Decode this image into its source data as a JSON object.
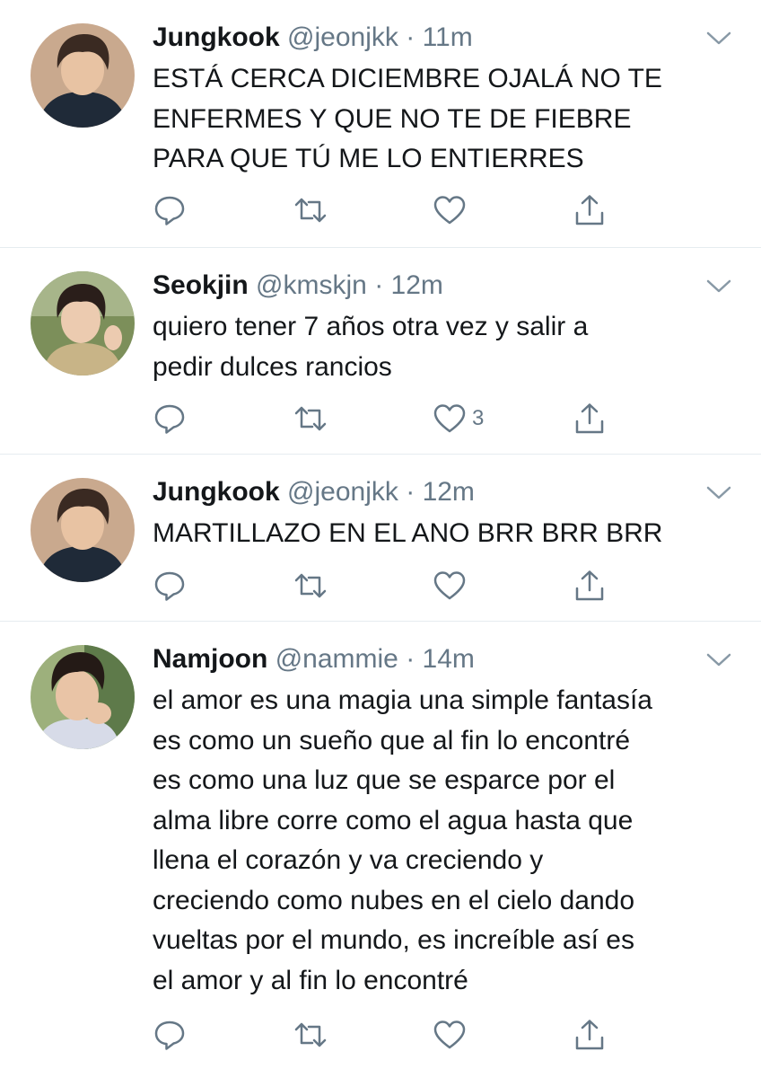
{
  "colors": {
    "name": "#14171a",
    "meta": "#657786",
    "divider": "#e6ecf0",
    "icon": "#657786"
  },
  "tweets": [
    {
      "name": "Jungkook",
      "handle": "@jeonjkk",
      "separator": "·",
      "time": "11m",
      "lines": [
        "ESTÁ CERCA DICIEMBRE OJALÁ NO TE",
        "ENFERMES Y QUE NO TE DE FIEBRE",
        "PARA QUE TÚ ME LO ENTIERRES"
      ],
      "like_count": ""
    },
    {
      "name": "Seokjin",
      "handle": "@kmskjn",
      "separator": "·",
      "time": "12m",
      "lines": [
        "quiero tener 7 años otra vez y salir a",
        "pedir dulces rancios"
      ],
      "like_count": "3"
    },
    {
      "name": "Jungkook",
      "handle": "@jeonjkk",
      "separator": "·",
      "time": "12m",
      "lines": [
        "MARTILLAZO EN EL ANO BRR BRR BRR"
      ],
      "like_count": ""
    },
    {
      "name": "Namjoon",
      "handle": "@nammie",
      "separator": "·",
      "time": "14m",
      "lines": [
        "el amor es una magia una simple fantasía",
        "es como un sueño que al fin lo encontré",
        "es como una luz que se esparce por el",
        "alma libre corre como el agua hasta que",
        "llena el corazón y va creciendo y",
        "creciendo como nubes en el cielo dando",
        "vueltas por el mundo, es increíble así es",
        "el amor y al fin lo encontré"
      ],
      "like_count": ""
    }
  ]
}
